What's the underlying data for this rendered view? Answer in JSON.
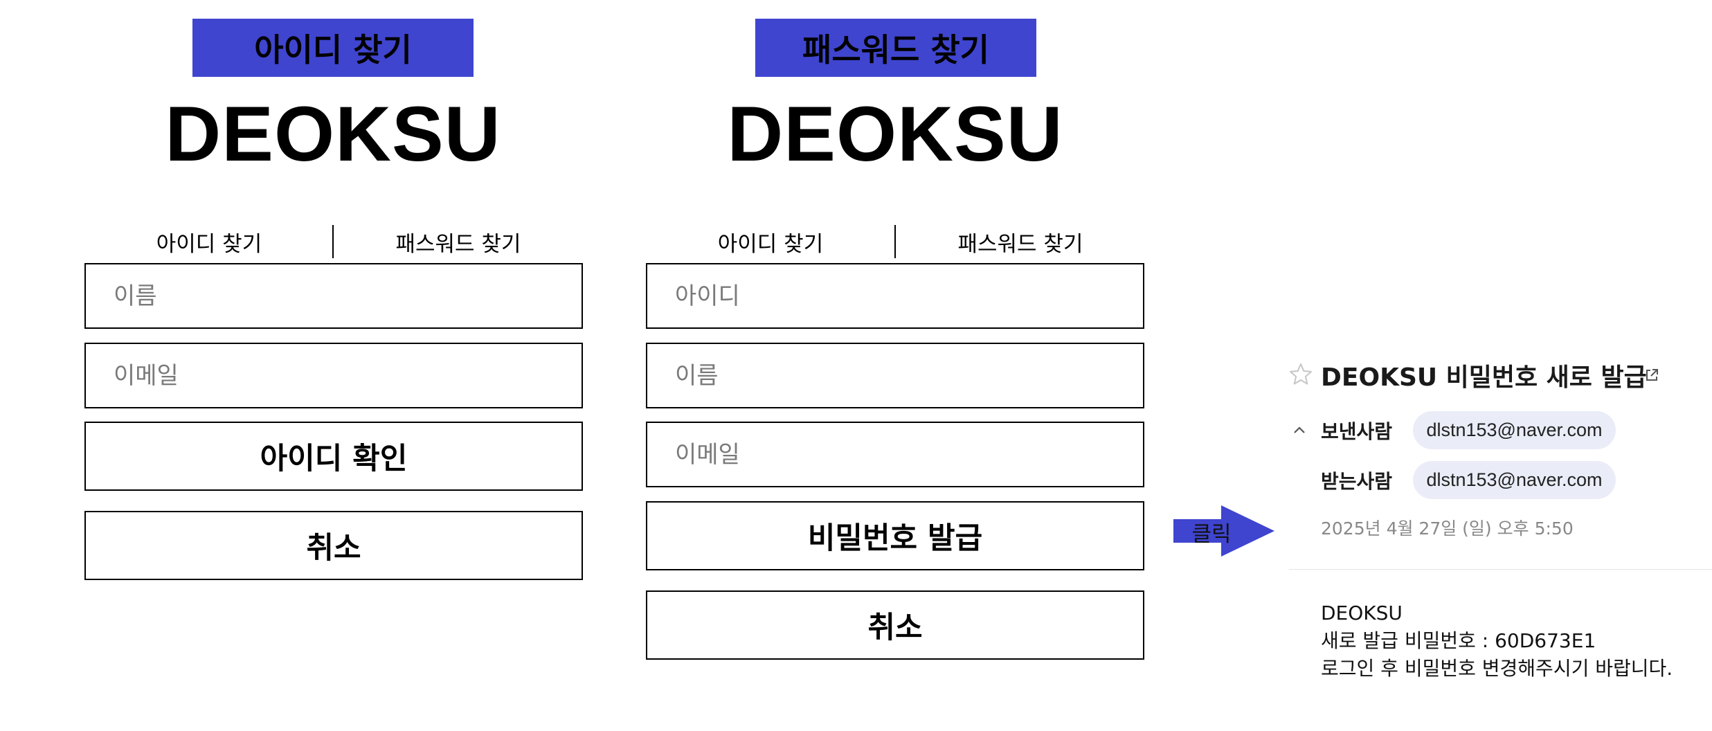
{
  "find_id_panel": {
    "banner": "아이디 찾기",
    "logo": "DEOKSU",
    "tabs": {
      "find_id": "아이디 찾기",
      "find_password": "패스워드 찾기"
    },
    "name_placeholder": "이름",
    "email_placeholder": "이메일",
    "confirm_button": "아이디 확인",
    "cancel_button": "취소"
  },
  "find_password_panel": {
    "banner": "패스워드 찾기",
    "logo": "DEOKSU",
    "tabs": {
      "find_id": "아이디 찾기",
      "find_password": "패스워드 찾기"
    },
    "id_placeholder": "아이디",
    "name_placeholder": "이름",
    "email_placeholder": "이메일",
    "issue_button": "비밀번호 발급",
    "cancel_button": "취소"
  },
  "arrow": {
    "label": "클릭",
    "color": "#3f45cf"
  },
  "email": {
    "subject": "DEOKSU 비밀번호 새로 발급",
    "sender_label": "보낸사람",
    "sender": "dlstn153@naver.com",
    "recipient_label": "받는사람",
    "recipient": "dlstn153@naver.com",
    "date": "2025년 4월 27일 (일) 오후 5:50",
    "body": [
      "DEOKSU",
      "새로 발급 비밀번호 : 60D673E1",
      "로그인 후 비밀번호 변경해주시기 바랍니다."
    ]
  },
  "colors": {
    "accent": "#3f45cf",
    "chip_bg": "#eaedf8",
    "date_text": "#888888"
  },
  "icons": [
    "star-icon",
    "external-link-icon",
    "chevron-up-icon",
    "arrow-right-icon"
  ]
}
